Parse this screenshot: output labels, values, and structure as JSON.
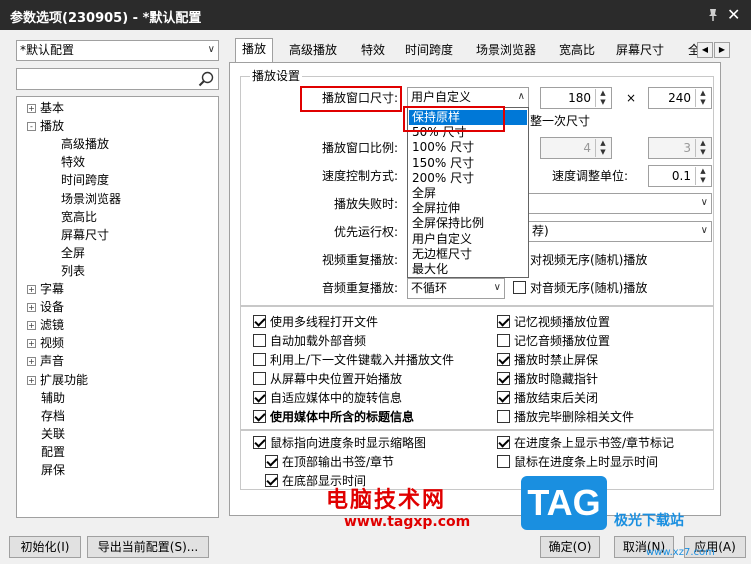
{
  "window": {
    "title": "参数选项(230905) - *默认配置"
  },
  "profile_select": {
    "value": "*默认配置"
  },
  "search": {
    "value": ""
  },
  "tree": [
    {
      "label": "基本",
      "expander": "+"
    },
    {
      "label": "播放",
      "expander": "-"
    },
    {
      "label": "高级播放"
    },
    {
      "label": "特效"
    },
    {
      "label": "时间跨度"
    },
    {
      "label": "场景浏览器"
    },
    {
      "label": "宽高比"
    },
    {
      "label": "屏幕尺寸"
    },
    {
      "label": "全屏"
    },
    {
      "label": "列表"
    },
    {
      "label": "字幕",
      "expander": "+"
    },
    {
      "label": "设备",
      "expander": "+"
    },
    {
      "label": "滤镜",
      "expander": "+"
    },
    {
      "label": "视频",
      "expander": "+"
    },
    {
      "label": "声音",
      "expander": "+"
    },
    {
      "label": "扩展功能",
      "expander": "+"
    },
    {
      "label": "辅助"
    },
    {
      "label": "存档"
    },
    {
      "label": "关联"
    },
    {
      "label": "配置"
    },
    {
      "label": "屏保"
    }
  ],
  "tabs": [
    "播放",
    "高级播放",
    "特效",
    "时间跨度",
    "场景浏览器",
    "宽高比",
    "屏幕尺寸",
    "全"
  ],
  "group_title": "播放设置",
  "fields": {
    "window_size_label": "播放窗口尺寸:",
    "window_size_value": "用户自定义",
    "width": "180",
    "times": "×",
    "height": "240",
    "adjust_once": "整一次尺寸",
    "ratio_label": "播放窗口比例:",
    "ratio_a": "4",
    "ratio_b": "3",
    "speed_label": "速度控制方式:",
    "speed_unit_label": "速度调整单位:",
    "speed_unit": "0.1",
    "fail_label": "播放失败时:",
    "priority_label": "优先运行权:",
    "priority_tail": "荐)",
    "video_repeat_label": "视频重复播放:",
    "video_random": "对视频无序(随机)播放",
    "audio_repeat_label": "音频重复播放:",
    "audio_repeat_value": "不循环",
    "audio_random": "对音频无序(随机)播放"
  },
  "dropdown_options": [
    "保持原样",
    "50% 尺寸",
    "100% 尺寸",
    "150% 尺寸",
    "200% 尺寸",
    "全屏",
    "全屏拉伸",
    "全屏保持比例",
    "用户自定义",
    "无边框尺寸",
    "最大化"
  ],
  "checks_left": [
    {
      "label": "使用多线程打开文件",
      "checked": true
    },
    {
      "label": "自动加载外部音频",
      "checked": false
    },
    {
      "label": "利用上/下一文件键载入并播放文件",
      "checked": false
    },
    {
      "label": "从屏幕中央位置开始播放",
      "checked": false
    },
    {
      "label": "自适应媒体中的旋转信息",
      "checked": true
    },
    {
      "label": "使用媒体中所含的标题信息",
      "checked": true
    }
  ],
  "checks_right": [
    {
      "label": "记忆视频播放位置",
      "checked": true
    },
    {
      "label": "记忆音频播放位置",
      "checked": false
    },
    {
      "label": "播放时禁止屏保",
      "checked": true
    },
    {
      "label": "播放时隐藏指针",
      "checked": true
    },
    {
      "label": "播放结束后关闭",
      "checked": true
    },
    {
      "label": "播放完毕删除相关文件",
      "checked": false
    }
  ],
  "checks_bottom": [
    {
      "label": "鼠标指向进度条时显示缩略图",
      "checked": true
    },
    {
      "label": "在顶部输出书签/章节",
      "checked": true
    },
    {
      "label": "在底部显示时间",
      "checked": true
    },
    {
      "label": "在进度条上显示书签/章节标记",
      "checked": true
    },
    {
      "label": "鼠标在进度条上时显示时间",
      "checked": false
    }
  ],
  "buttons": {
    "init": "初始化(I)",
    "export": "导出当前配置(S)...",
    "ok": "确定(O)",
    "cancel": "取消(N)",
    "apply": "应用(A)"
  },
  "watermark": {
    "site_name": "电脑技术网",
    "site_url": "www.tagxp.com",
    "logo": "TAG",
    "logo_sub": "极光下载站",
    "logo_url": "www.xz7.com"
  },
  "colors": {
    "accent": "#0078d7",
    "highlight": "#e00000",
    "logo": "#1a8fe0"
  }
}
